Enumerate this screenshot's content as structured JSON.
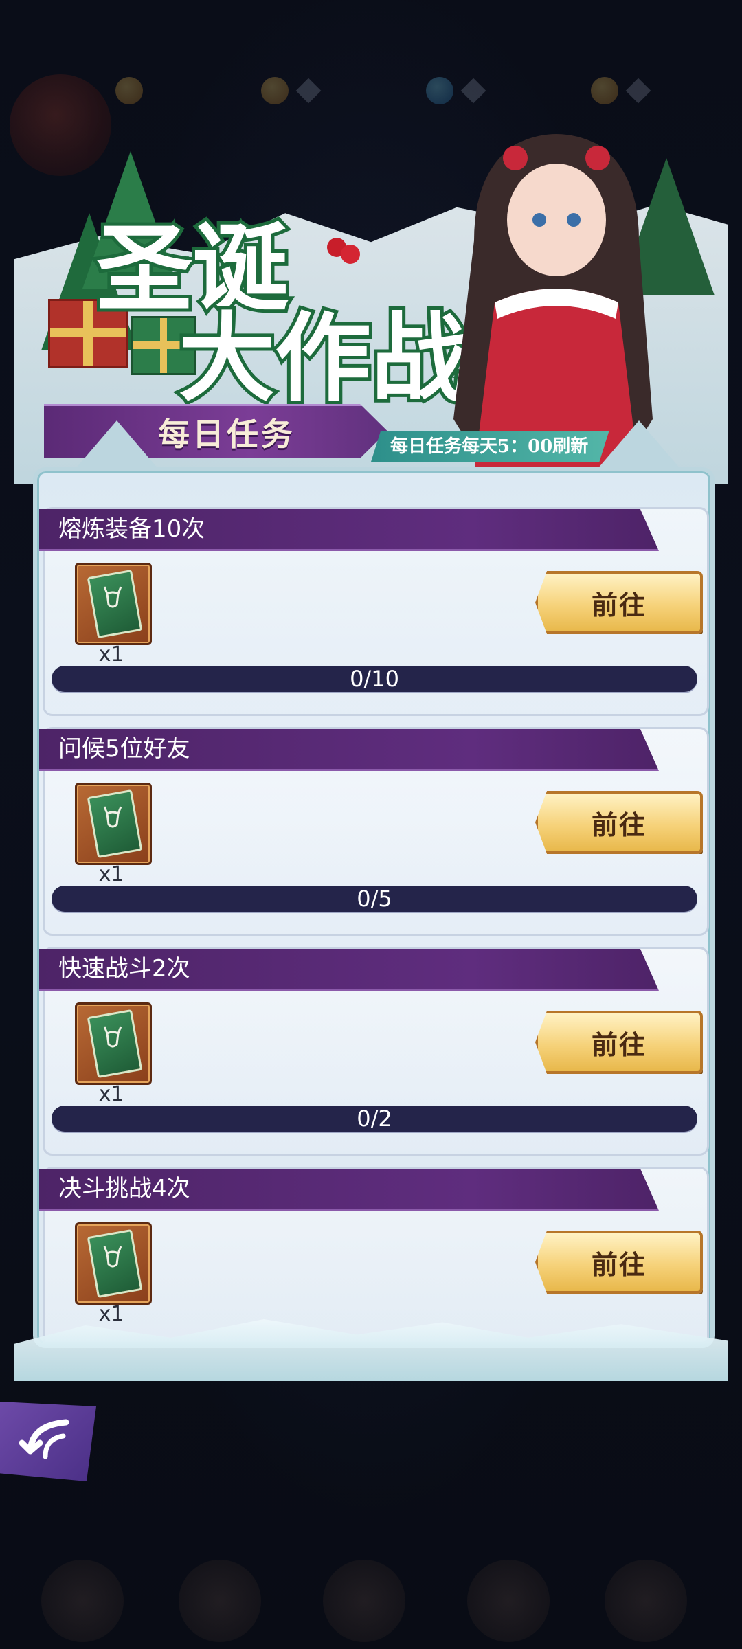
{
  "banner": {
    "title_line1": "圣诞",
    "title_line2": "大作战",
    "tab_label": "每日任务",
    "refresh_note": "每日任务每天5：00刷新"
  },
  "tasks": [
    {
      "title": "熔炼装备10次",
      "reward_icon": "reindeer-card-icon",
      "reward_qty": "x1",
      "button_label": "前往",
      "progress_text": "0/10",
      "progress": 0
    },
    {
      "title": "问候5位好友",
      "reward_icon": "reindeer-card-icon",
      "reward_qty": "x1",
      "button_label": "前往",
      "progress_text": "0/5",
      "progress": 0
    },
    {
      "title": "快速战斗2次",
      "reward_icon": "reindeer-card-icon",
      "reward_qty": "x1",
      "button_label": "前往",
      "progress_text": "0/2",
      "progress": 0
    },
    {
      "title": "决斗挑战4次",
      "reward_icon": "reindeer-card-icon",
      "reward_qty": "x1",
      "button_label": "前往",
      "progress_text": "",
      "progress": 0
    }
  ],
  "colors": {
    "task_header": "#5f2d7e",
    "button_gold": "#f6d27a",
    "progress_track": "#24244a",
    "accent_teal": "#53b6a8"
  },
  "icons": {
    "back": "back-arrow-icon"
  }
}
